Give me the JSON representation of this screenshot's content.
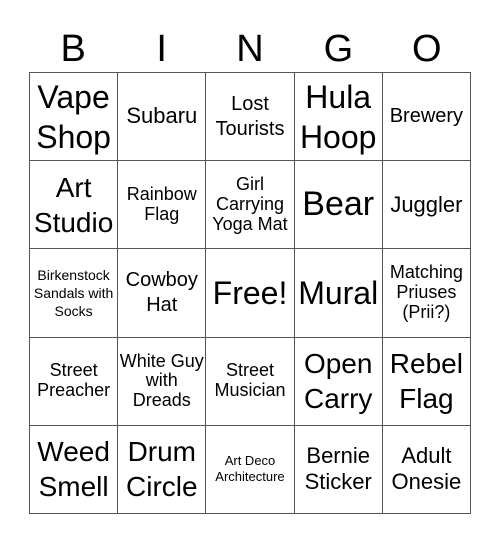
{
  "header": [
    "B",
    "I",
    "N",
    "G",
    "O"
  ],
  "cells": [
    "Vape Shop",
    "Subaru",
    "Lost Tourists",
    "Hula Hoop",
    "Brewery",
    "Art Studio",
    "Rainbow Flag",
    "Girl Carrying Yoga Mat",
    "Bear",
    "Juggler",
    "Birkenstock Sandals with Socks",
    "Cowboy Hat",
    "Free!",
    "Mural",
    "Matching Priuses (Prii?)",
    "Street Preacher",
    "White Guy with Dreads",
    "Street Musician",
    "Open Carry",
    "Rebel Flag",
    "Weed Smell",
    "Drum Circle",
    "Art Deco Architecture",
    "Bernie Sticker",
    "Adult Onesie"
  ]
}
